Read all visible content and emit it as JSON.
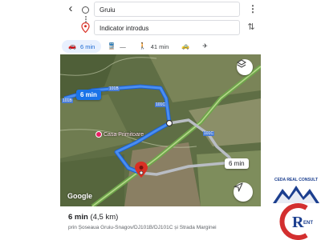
{
  "search": {
    "origin_value": "Gruiu",
    "destination_placeholder": "Indicator introdus",
    "back_glyph": "‹",
    "more_glyph": "⋮",
    "swap_glyph": "⇅"
  },
  "modes": [
    {
      "name": "car",
      "icon": "car-icon",
      "glyph": "🚗",
      "label": "6 min",
      "active": true
    },
    {
      "name": "transit",
      "icon": "transit-icon",
      "glyph": "🚆",
      "label": "—",
      "active": false
    },
    {
      "name": "walk",
      "icon": "walk-icon",
      "glyph": "🚶",
      "label": "41 min",
      "active": false
    },
    {
      "name": "ride",
      "icon": "ride-icon",
      "glyph": "🚕",
      "label": "",
      "active": false
    },
    {
      "name": "flight",
      "icon": "plane-icon",
      "glyph": "✈",
      "label": "",
      "active": false
    }
  ],
  "map": {
    "route_callout_primary": "6 min",
    "route_callout_alt": "6 min",
    "place_name": "Casa Primitoare",
    "road_labels": [
      "101B",
      "101C",
      "101B",
      "101C"
    ],
    "google_label": "Google",
    "colors": {
      "route_primary": "#4a8ef0",
      "route_alt": "#b9bdc4",
      "destination_pin": "#d93025",
      "highway": "#7fb257"
    }
  },
  "sheet": {
    "duration": "6 min",
    "distance": "(4,5 km)",
    "route_desc": "prin Șoseaua Gruiu-Snagov/DJ101B/DJ101C și Strada Marginei"
  },
  "watermark": {
    "caption": "CEDA REAL CONSULT",
    "letters": "C  R  ENT"
  }
}
